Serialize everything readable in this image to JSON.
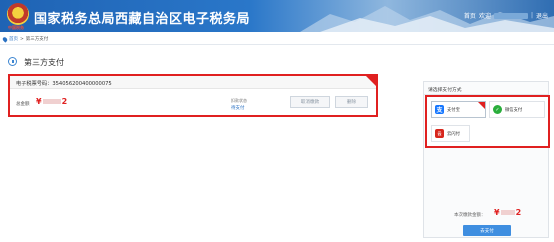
{
  "header": {
    "title": "国家税务总局西藏自治区电子税务局",
    "emblem_text": "中国税务",
    "nav": {
      "home": "首页",
      "welcome": "欢迎",
      "exit": "退出"
    }
  },
  "breadcrumb": {
    "home": "首页",
    "separator": ">",
    "current": "第三方支付"
  },
  "page_title": "第三方支付",
  "bill": {
    "code_label": "电子税票号码：",
    "code_value": "354056200400000075",
    "total_label": "总金额",
    "total_amount_prefix": "¥",
    "total_amount_suffix": "2",
    "status_label": "扣款状态",
    "status_value": "待支付",
    "cancel_label": "取消缴款",
    "delete_label": "删除"
  },
  "panel": {
    "title": "请选择支付方式",
    "methods": [
      {
        "label": "支付宝",
        "icon": "alipay-icon",
        "glyph": "支",
        "selected": true
      },
      {
        "label": "微信支付",
        "icon": "wechat-pay-icon",
        "glyph": "✓",
        "selected": false
      },
      {
        "label": "云闪付",
        "icon": "unionpay-icon",
        "glyph": "云",
        "selected": false
      }
    ],
    "pay_amount_label": "本次缴款金额：",
    "pay_amount_prefix": "¥",
    "pay_amount_suffix": "2",
    "pay_button": "去支付"
  },
  "colors": {
    "brand_blue": "#2b72c3",
    "highlight_red": "#e02020",
    "amount_red": "#e02020",
    "alipay_blue": "#1677ff",
    "wechat_green": "#2aae3c",
    "unionpay_red": "#d7261c"
  }
}
